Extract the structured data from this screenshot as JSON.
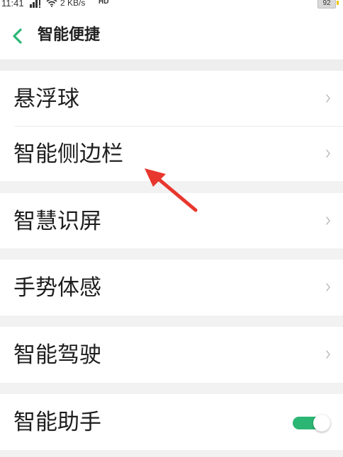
{
  "status_bar": {
    "time": "11:41",
    "network_speed": "2 KB/s",
    "hd_badge": "HD",
    "battery": "92"
  },
  "header": {
    "title": "智能便捷"
  },
  "items": [
    {
      "label": "悬浮球"
    },
    {
      "label": "智能侧边栏"
    },
    {
      "label": "智慧识屏"
    },
    {
      "label": "手势体感"
    },
    {
      "label": "智能驾驶"
    },
    {
      "label": "智能助手",
      "toggle_on": true
    }
  ],
  "colors": {
    "accent": "#2bb673",
    "annotation_arrow": "#e8372e"
  },
  "icons": {
    "back": "chevron-left-icon",
    "row": "chevron-right-icon",
    "annotation": "red-arrow-icon"
  }
}
